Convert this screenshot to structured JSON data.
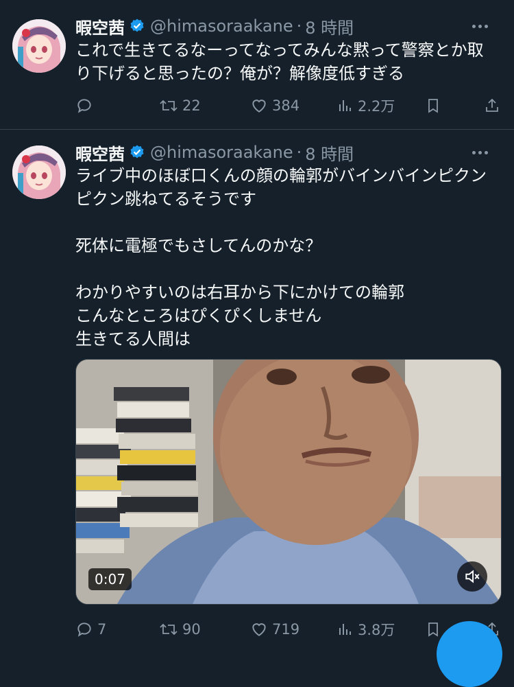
{
  "tweets": [
    {
      "name": "暇空茜",
      "handle": "@himasoraakane",
      "separator": "·",
      "time": "8 時間",
      "text": "これで生きてるなーってなってみんな黙って警察とか取り下げると思ったの？俺が？解像度低すぎる",
      "replies": "",
      "retweets": "22",
      "likes": "384",
      "views": "2.2万"
    },
    {
      "name": "暇空茜",
      "handle": "@himasoraakane",
      "separator": "·",
      "time": "8 時間",
      "text": "ライブ中のほぼ口くんの顔の輪郭がバインバインピクンピクン跳ねてるそうです\n\n死体に電極でもさしてんのかな？\n\nわかりやすいのは右耳から下にかけての輪郭\nこんなところはぴくぴくしません\n生きてる人間は",
      "video_time": "0:07",
      "replies": "7",
      "retweets": "90",
      "likes": "719",
      "views": "3.8万"
    }
  ],
  "colors": {
    "background": "#15202b",
    "text": "#f7f9f9",
    "secondary": "#8b98a5",
    "accent": "#1d9bf0",
    "divider": "#38444d"
  },
  "icons": [
    "verified-badge-icon",
    "more-icon",
    "reply-icon",
    "retweet-icon",
    "like-icon",
    "views-icon",
    "bookmark-icon",
    "share-icon",
    "mute-icon"
  ]
}
